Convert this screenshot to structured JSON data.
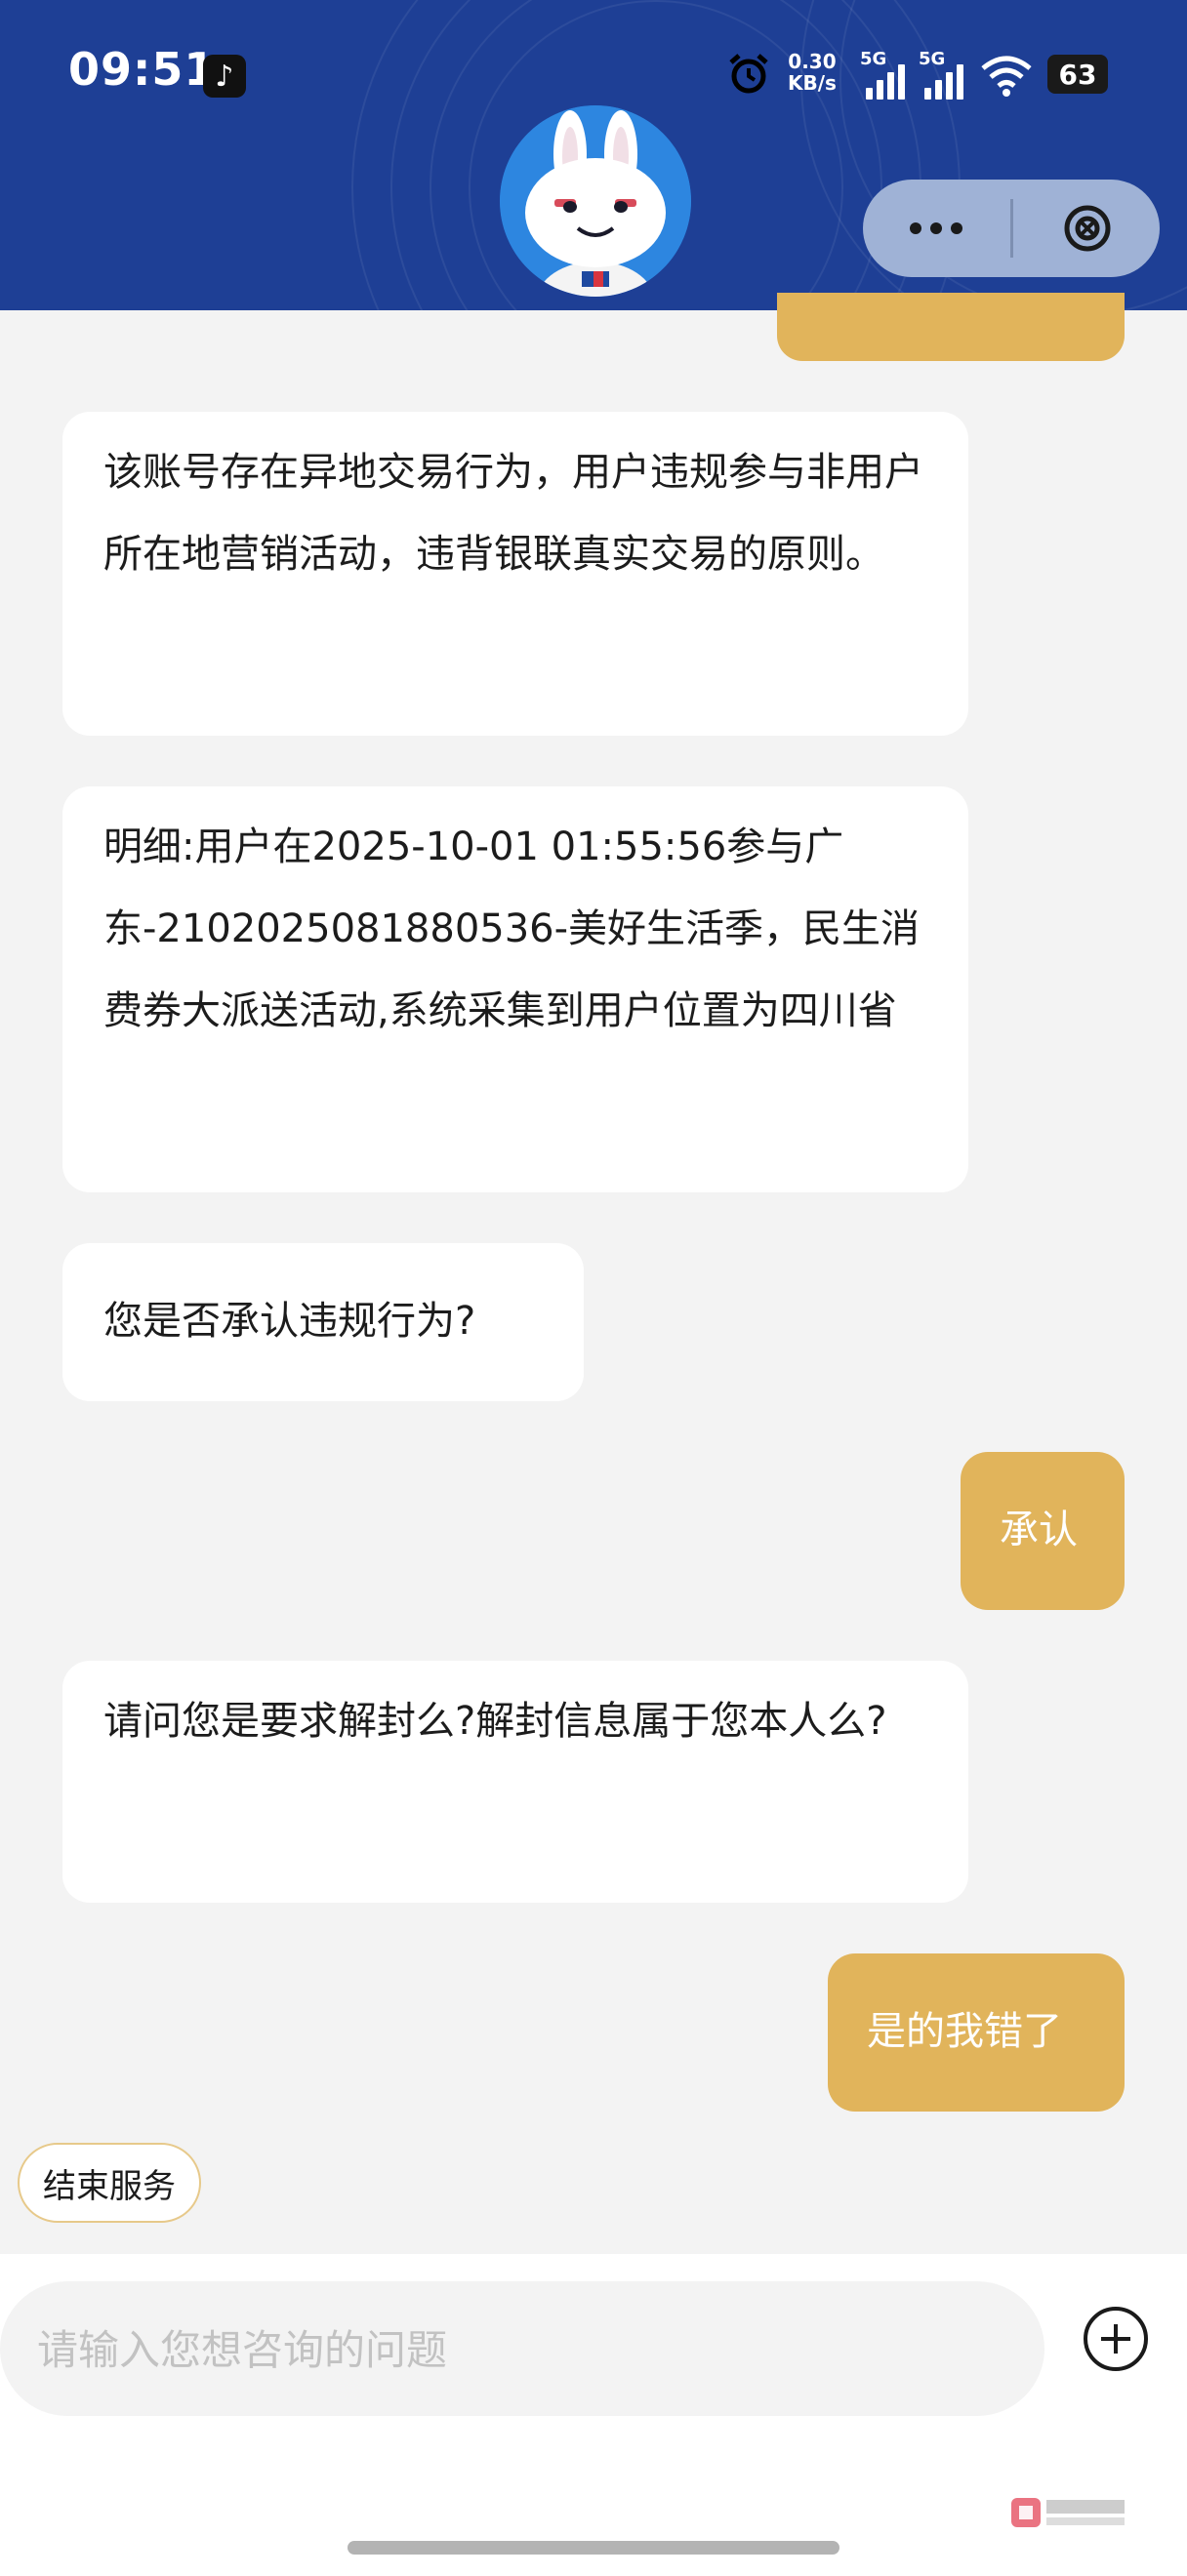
{
  "status_bar": {
    "time": "09:51",
    "net_speed_value": "0.30",
    "net_speed_unit": "KB/s",
    "signal1_label": "5G",
    "signal2_label": "5G",
    "battery": "63"
  },
  "messages": [
    {
      "role": "bot",
      "text": "该账号存在异地交易行为，用户违规参与非用户所在地营销活动，违背银联真实交易的原则。"
    },
    {
      "role": "bot",
      "text": "明细:用户在2025-10-01 01:55:56参与广东-2102025081880536-美好生活季，民生消费券大派送活动,系统采集到用户位置为四川省"
    },
    {
      "role": "bot",
      "text": "您是否承认违规行为?"
    },
    {
      "role": "user",
      "text": "承认"
    },
    {
      "role": "bot",
      "text": "请问您是要求解封么?解封信息属于您本人么?"
    },
    {
      "role": "user",
      "text": "是的我错了"
    }
  ],
  "end_service_label": "结束服务",
  "input": {
    "placeholder": "请输入您想咨询的问题",
    "value": ""
  },
  "colors": {
    "header_bg": "#1e3f95",
    "user_bubble": "#e1b45b",
    "bot_bubble": "#ffffff",
    "page_bg": "#f3f3f3"
  },
  "icons": [
    "tiktok-icon",
    "alarm-icon",
    "wifi-icon",
    "more-icon",
    "close-icon",
    "plus-icon",
    "mascot-avatar"
  ]
}
